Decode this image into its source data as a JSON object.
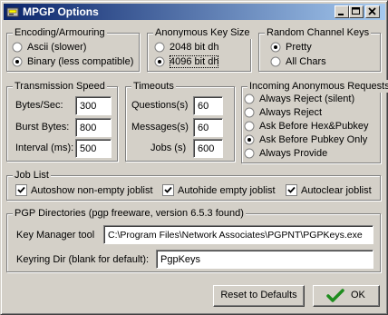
{
  "window": {
    "title": "MPGP Options"
  },
  "encoding": {
    "legend": "Encoding/Armouring",
    "options": [
      {
        "label": "Ascii (slower)",
        "selected": false
      },
      {
        "label": "Binary (less compatible)",
        "selected": true
      }
    ]
  },
  "anon_key_size": {
    "legend": "Anonymous Key Size",
    "options": [
      {
        "label": "2048 bit dh",
        "selected": false
      },
      {
        "label": "4096 bit dh",
        "selected": true
      }
    ]
  },
  "random_channel_keys": {
    "legend": "Random Channel Keys",
    "options": [
      {
        "label": "Pretty",
        "selected": true
      },
      {
        "label": "All Chars",
        "selected": false
      }
    ]
  },
  "transmission_speed": {
    "legend": "Transmission Speed",
    "fields": [
      {
        "label": "Bytes/Sec:",
        "value": "300"
      },
      {
        "label": "Burst Bytes:",
        "value": "800"
      },
      {
        "label": "Interval (ms):",
        "value": "500"
      }
    ]
  },
  "timeouts": {
    "legend": "Timeouts",
    "fields": [
      {
        "label": "Questions(s)",
        "value": "60"
      },
      {
        "label": "Messages(s)",
        "value": "60"
      },
      {
        "label": "Jobs (s)",
        "value": "600"
      }
    ]
  },
  "incoming_requests": {
    "legend": "Incoming Anonymous Requests",
    "options": [
      {
        "label": "Always Reject (silent)",
        "selected": false
      },
      {
        "label": "Always Reject",
        "selected": false
      },
      {
        "label": "Ask Before Hex&Pubkey",
        "selected": false
      },
      {
        "label": "Ask Before Pubkey Only",
        "selected": true
      },
      {
        "label": "Always Provide",
        "selected": false
      }
    ]
  },
  "job_list": {
    "legend": "Job List",
    "checks": [
      {
        "label": "Autoshow non-empty joblist",
        "checked": true
      },
      {
        "label": "Autohide empty joblist",
        "checked": true
      },
      {
        "label": "Autoclear joblist",
        "checked": true
      }
    ]
  },
  "pgp_dirs": {
    "legend": "PGP Directories (pgp freeware, version 6.5.3 found)",
    "key_manager_label": "Key Manager tool",
    "key_manager_value": "C:\\Program Files\\Network Associates\\PGPNT\\PGPKeys.exe",
    "keyring_label": "Keyring Dir (blank for default):",
    "keyring_value": "PgpKeys"
  },
  "buttons": {
    "reset": "Reset to Defaults",
    "ok": "OK"
  },
  "colors": {
    "title_start": "#0a246a",
    "title_end": "#a6caf0",
    "face": "#d4d0c8",
    "ok_check": "#1e8c1e"
  }
}
